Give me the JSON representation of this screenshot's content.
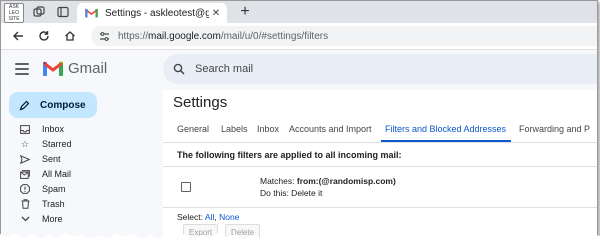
{
  "browser": {
    "profile_lines": [
      "ASK",
      "LEO",
      "SITE"
    ],
    "tab": {
      "title": "Settings - askleotest@gmail.com"
    },
    "address": {
      "prefix": "https://",
      "host": "mail.google.com",
      "path": "/mail/u/0/#settings/filters"
    }
  },
  "gmail": {
    "brand": "Gmail",
    "search_placeholder": "Search mail",
    "compose_label": "Compose",
    "nav": [
      {
        "label": "Inbox",
        "icon": "inbox-icon"
      },
      {
        "label": "Starred",
        "icon": "star-icon"
      },
      {
        "label": "Sent",
        "icon": "send-icon"
      },
      {
        "label": "All Mail",
        "icon": "all-mail-icon"
      },
      {
        "label": "Spam",
        "icon": "spam-icon"
      },
      {
        "label": "Trash",
        "icon": "trash-icon"
      },
      {
        "label": "More",
        "icon": "chevron-down-icon"
      }
    ]
  },
  "settings": {
    "title": "Settings",
    "tabs": [
      "General",
      "Labels",
      "Inbox",
      "Accounts and Import",
      "Filters and Blocked Addresses",
      "Forwarding and P"
    ],
    "active_tab": "Filters and Blocked Addresses",
    "filters_heading": "The following filters are applied to all incoming mail:",
    "filter": {
      "matches_label": "Matches: ",
      "matches_value": "from:(@randomisp.com)",
      "action": "Do this: Delete it"
    },
    "select": {
      "label": "Select: ",
      "all": "All",
      "sep": ", ",
      "none": "None"
    },
    "buttons": {
      "export": "Export",
      "delete": "Delete"
    }
  },
  "colors": {
    "accent": "#0b57d0",
    "compose_bg": "#c2e7ff",
    "gmail_bg": "#f6f8fc"
  }
}
